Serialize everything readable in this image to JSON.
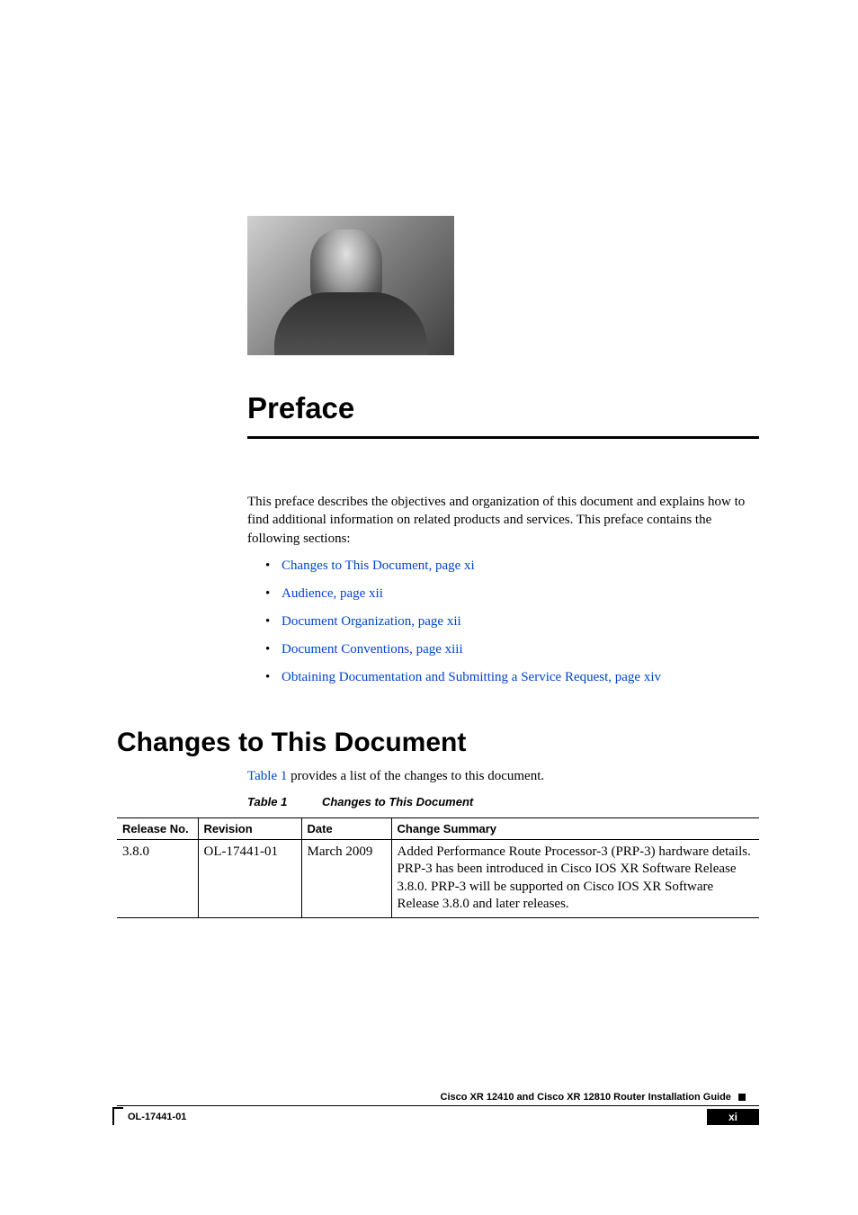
{
  "chapter": {
    "title": "Preface",
    "intro": "This preface describes the objectives and organization of this document and explains how to find additional information on related products and services. This preface contains the following sections:",
    "bullets": [
      "Changes to This Document, page xi",
      "Audience, page xii",
      "Document Organization, page xii",
      "Document Conventions, page xiii",
      "Obtaining Documentation and Submitting a Service Request, page xiv"
    ]
  },
  "section": {
    "heading": "Changes to This Document",
    "body_prefix": "",
    "body_link": "Table 1",
    "body_suffix": " provides a list of the changes to this document.",
    "table_caption_label": "Table 1",
    "table_caption_title": "Changes to This Document"
  },
  "table": {
    "headers": {
      "release": "Release No.",
      "revision": "Revision",
      "date": "Date",
      "summary": "Change Summary"
    },
    "rows": [
      {
        "release": "3.8.0",
        "revision": "OL-17441-01",
        "date": "March 2009",
        "summary": "Added Performance Route Processor-3 (PRP-3) hardware details. PRP-3 has been introduced in Cisco IOS XR Software Release 3.8.0. PRP-3 will be supported on Cisco IOS XR Software Release 3.8.0 and later releases."
      }
    ]
  },
  "footer": {
    "doc_title": "Cisco XR 12410 and Cisco XR 12810 Router Installation Guide",
    "doc_number": "OL-17441-01",
    "page_number": "xi"
  }
}
